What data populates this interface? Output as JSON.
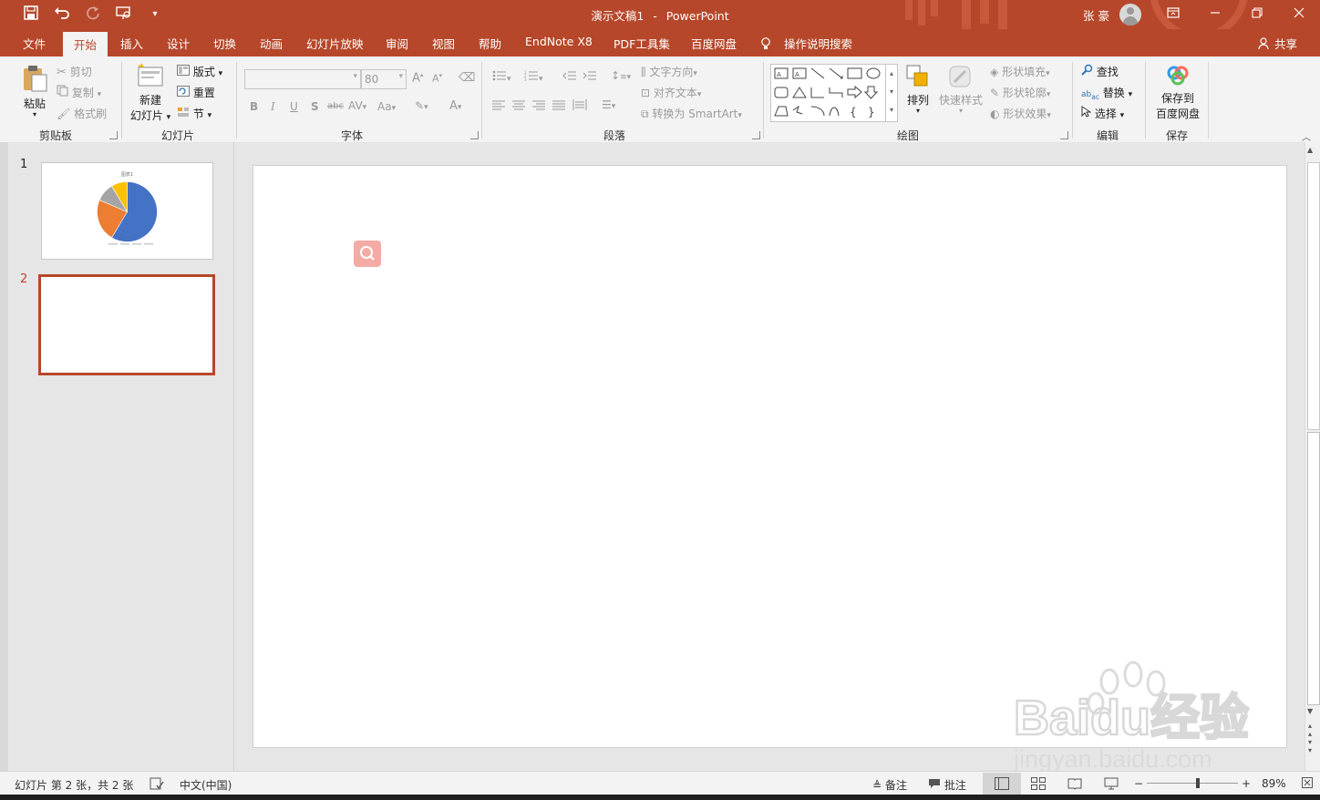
{
  "window": {
    "doc_name": "演示文稿1",
    "separator": "-",
    "app_name": "PowerPoint",
    "user": "张 豪",
    "theme_color": "#b7472a"
  },
  "tabs": [
    {
      "label": "文件"
    },
    {
      "label": "开始",
      "active": true
    },
    {
      "label": "插入"
    },
    {
      "label": "设计"
    },
    {
      "label": "切换"
    },
    {
      "label": "动画"
    },
    {
      "label": "幻灯片放映"
    },
    {
      "label": "审阅"
    },
    {
      "label": "视图"
    },
    {
      "label": "帮助"
    },
    {
      "label": "EndNote X8"
    },
    {
      "label": "PDF工具集"
    },
    {
      "label": "百度网盘"
    }
  ],
  "tell_me": "操作说明搜索",
  "share": "共享",
  "ribbon": {
    "clipboard": {
      "paste": "粘贴",
      "cut": "剪切",
      "copy": "复制",
      "format_painter": "格式刷",
      "label": "剪贴板"
    },
    "slides": {
      "new_slide_line1": "新建",
      "new_slide_line2": "幻灯片",
      "layout": "版式",
      "reset": "重置",
      "section": "节",
      "label": "幻灯片"
    },
    "font": {
      "font_name": "",
      "font_size": "80",
      "bold": "B",
      "italic": "I",
      "underline": "U",
      "shadow": "S",
      "strike": "abc",
      "case": "Aa",
      "label": "字体"
    },
    "paragraph": {
      "text_direction": "文字方向",
      "align_text": "对齐文本",
      "smartart": "转换为 SmartArt",
      "label": "段落"
    },
    "drawing": {
      "arrange": "排列",
      "quick_styles": "快速样式",
      "shape_fill": "形状填充",
      "shape_outline": "形状轮廓",
      "shape_effects": "形状效果",
      "label": "绘图"
    },
    "editing": {
      "find": "查找",
      "replace": "替换",
      "select": "选择",
      "label": "编辑"
    },
    "save": {
      "line1": "保存到",
      "line2": "百度网盘",
      "label": "保存"
    }
  },
  "thumbnails": [
    {
      "number": "1",
      "title": "图表1",
      "pie": [
        {
          "value": 8.2,
          "color": "#4472c4"
        },
        {
          "value": 3.2,
          "color": "#ed7d31"
        },
        {
          "value": 1.4,
          "color": "#a5a5a5"
        },
        {
          "value": 1.2,
          "color": "#ffc000"
        }
      ]
    },
    {
      "number": "2",
      "selected": true
    }
  ],
  "status": {
    "slide_info": "幻灯片 第 2 张，共 2 张",
    "language": "中文(中国)",
    "notes": "备注",
    "comments": "批注",
    "zoom_minus": "−",
    "zoom_plus": "+",
    "zoom": "89%",
    "zoom_level": 0.56
  },
  "watermark": {
    "logo": "Baidu经验",
    "url": "jingyan.baidu.com"
  }
}
